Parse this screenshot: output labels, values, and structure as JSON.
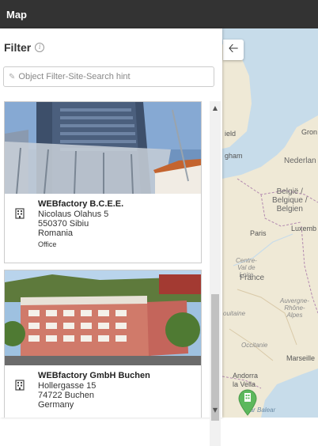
{
  "header": {
    "title": "Map"
  },
  "panel": {
    "filter_label": "Filter",
    "search_placeholder": "Object Filter-Site-Search hint"
  },
  "sites": [
    {
      "name": "WEBfactory B.C.E.E.",
      "street": "Nicolaus Olahus 5",
      "city": "550370 Sibiu",
      "country": "Romania",
      "type": "Office"
    },
    {
      "name": "WEBfactory GmbH Buchen",
      "street": "Hollergasse 15",
      "city": "74722 Buchen",
      "country": "Germany",
      "type": ""
    }
  ],
  "map": {
    "labels": {
      "ield": "ield",
      "gham": "gham",
      "gron": "Gron",
      "nederland": "Nederlan",
      "belgie": "België /\nBelgique /\nBelgien",
      "luxemb": "Luxemb",
      "paris": "Paris",
      "centre": "Centre-\nVal de\nLoire",
      "france": "France",
      "auvergne": "Auvergne-\nRhône-\nAlpes",
      "ouitaine": "ouitaine",
      "occitanie": "Occitanie",
      "marseille": "Marseille",
      "andorra": "Andorra\nla Vella",
      "mar_balear": "Mar Balear"
    },
    "colors": {
      "land": "#efe9d6",
      "water": "#c7dcea",
      "marker": "#5cb85c"
    }
  }
}
